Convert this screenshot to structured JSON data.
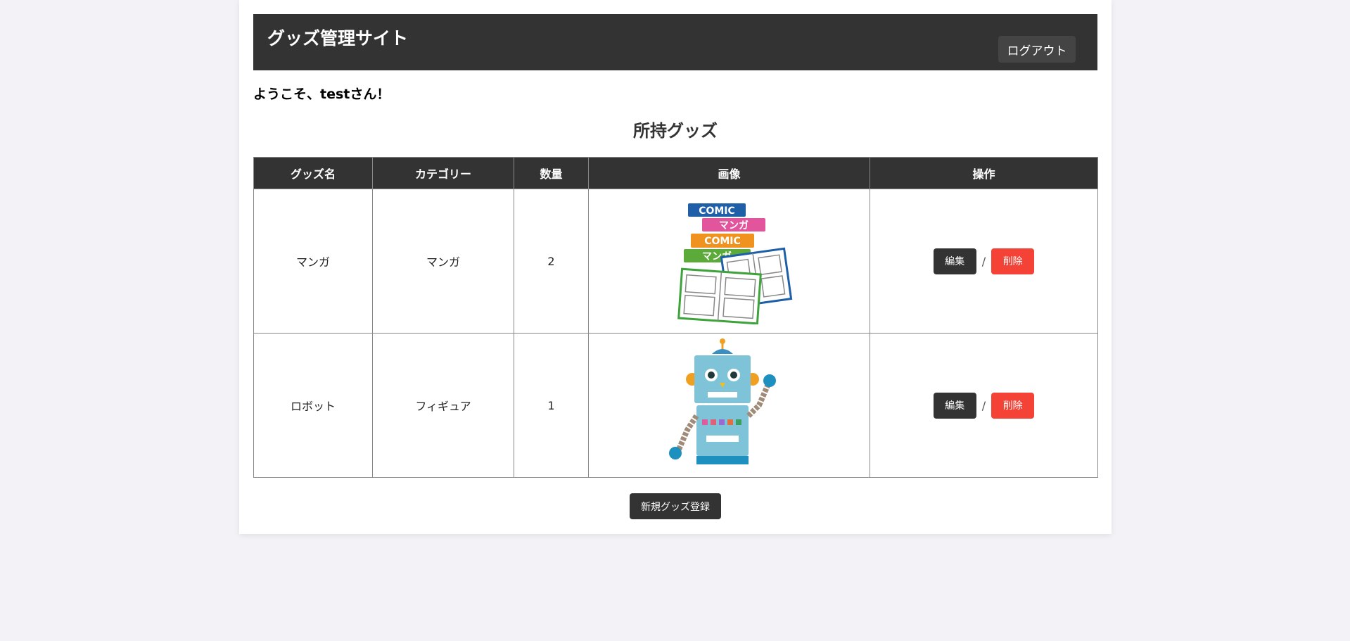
{
  "header": {
    "title": "グッズ管理サイト",
    "logout_label": "ログアウト"
  },
  "welcome_text": "ようこそ、testさん！",
  "section_title": "所持グッズ",
  "table": {
    "columns": [
      "グッズ名",
      "カテゴリー",
      "数量",
      "画像",
      "操作"
    ],
    "rows": [
      {
        "name": "マンガ",
        "category": "マンガ",
        "quantity": "2",
        "image": "manga-illustration",
        "image_text": [
          "COMIC",
          "マンガ",
          "COMIC",
          "マンガ"
        ],
        "edit_label": "編集",
        "separator": "/",
        "delete_label": "削除"
      },
      {
        "name": "ロボット",
        "category": "フィギュア",
        "quantity": "1",
        "image": "robot-illustration",
        "edit_label": "編集",
        "separator": "/",
        "delete_label": "削除"
      }
    ]
  },
  "new_goods_label": "新規グッズ登録",
  "colors": {
    "header_bg": "#333333",
    "delete_red": "#f44336",
    "page_bg": "#f3f3f7"
  }
}
